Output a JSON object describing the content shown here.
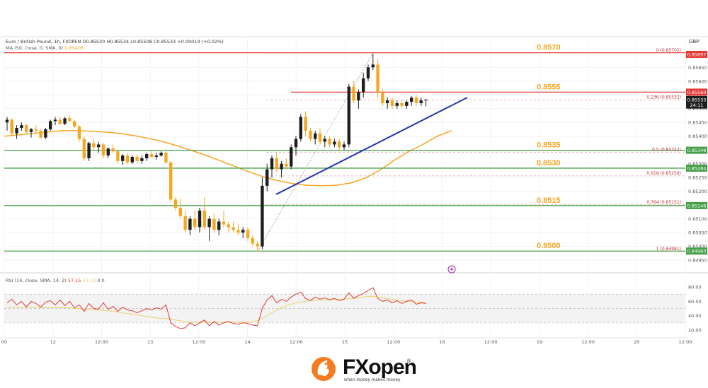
{
  "header": {
    "symbol_line": "Euro / British Pound, 1h, FXOPEN  O0.85520  H0.85534  L0.85508  C0.85533  +0.00014 (+0.02%)",
    "ma_line_prefix": "MA (50, close, 0, SMA, 0)",
    "ma_value": "0.85406",
    "currency": "GBP"
  },
  "rsi_header": {
    "prefix": "RSI (14, close, SMA, 14, 2)",
    "rsi_value": "57.15",
    "sma_value": "52.13",
    "suffix": "0  0"
  },
  "colors": {
    "bull": "#1e1e1e",
    "bear": "#f5a623",
    "ma": "#f5a623",
    "trendline": "#2233bb",
    "resistance": "#e53935",
    "support": "#43a047",
    "level_text": "#f5a623",
    "rsi": "#e53935",
    "rsi_sma": "#e8d36a"
  },
  "icons": [
    "lightning-icon"
  ],
  "brand": {
    "name": "FXopen",
    "tagline": "when money makes money",
    "reg": "®"
  },
  "chart_data": {
    "type": "candlestick",
    "title": "Euro / British Pound, 1h, FXOPEN",
    "ylim": [
      0.8494,
      0.8572
    ],
    "y_ticks": [
      "0.85650",
      "0.85600",
      "0.85550",
      "0.85500",
      "0.85450",
      "0.85400",
      "0.85350",
      "0.85300",
      "0.85250",
      "0.85200",
      "0.85150",
      "0.85100",
      "0.85050",
      "0.85000",
      "0.84950"
    ],
    "x_ticks": [
      "00",
      "12",
      "12:00",
      "13",
      "12:00",
      "14",
      "12:00",
      "15",
      "12:00",
      "16",
      "12:00",
      "19",
      "12:00",
      "20",
      "12:00"
    ],
    "candles": [
      [
        0.8545,
        0.8547,
        0.8542,
        0.8546
      ],
      [
        0.8546,
        0.85465,
        0.854,
        0.8541
      ],
      [
        0.8541,
        0.8544,
        0.8539,
        0.8543
      ],
      [
        0.8543,
        0.8545,
        0.8542,
        0.8544
      ],
      [
        0.8544,
        0.85445,
        0.8541,
        0.85415
      ],
      [
        0.85415,
        0.8543,
        0.85395,
        0.85425
      ],
      [
        0.85425,
        0.8544,
        0.8541,
        0.8542
      ],
      [
        0.8542,
        0.85425,
        0.8539,
        0.85395
      ],
      [
        0.85395,
        0.8543,
        0.8539,
        0.85425
      ],
      [
        0.85425,
        0.8546,
        0.8542,
        0.85455
      ],
      [
        0.85455,
        0.8547,
        0.8544,
        0.8546
      ],
      [
        0.8546,
        0.8547,
        0.8544,
        0.85445
      ],
      [
        0.85445,
        0.8547,
        0.8544,
        0.85465
      ],
      [
        0.85465,
        0.85475,
        0.8545,
        0.85455
      ],
      [
        0.85455,
        0.8546,
        0.8543,
        0.85435
      ],
      [
        0.85435,
        0.8544,
        0.8538,
        0.8539
      ],
      [
        0.8539,
        0.854,
        0.8531,
        0.8532
      ],
      [
        0.8532,
        0.8538,
        0.8531,
        0.85375
      ],
      [
        0.85375,
        0.8539,
        0.8535,
        0.8536
      ],
      [
        0.8536,
        0.8538,
        0.8534,
        0.8537
      ],
      [
        0.8537,
        0.85375,
        0.8532,
        0.8533
      ],
      [
        0.8533,
        0.8536,
        0.8532,
        0.85355
      ],
      [
        0.85355,
        0.8537,
        0.8534,
        0.85345
      ],
      [
        0.85345,
        0.8535,
        0.853,
        0.8531
      ],
      [
        0.8531,
        0.85335,
        0.85295,
        0.8533
      ],
      [
        0.8533,
        0.8534,
        0.853,
        0.85305
      ],
      [
        0.85305,
        0.8533,
        0.853,
        0.85325
      ],
      [
        0.85325,
        0.85335,
        0.85305,
        0.8531
      ],
      [
        0.8531,
        0.8533,
        0.853,
        0.8532
      ],
      [
        0.8532,
        0.8534,
        0.8531,
        0.85335
      ],
      [
        0.85335,
        0.85345,
        0.8532,
        0.85325
      ],
      [
        0.85325,
        0.8534,
        0.85315,
        0.8533
      ],
      [
        0.8533,
        0.85345,
        0.85325,
        0.8534
      ],
      [
        0.8534,
        0.85345,
        0.853,
        0.85305
      ],
      [
        0.85305,
        0.8531,
        0.8516,
        0.8517
      ],
      [
        0.8517,
        0.8518,
        0.8513,
        0.8514
      ],
      [
        0.8514,
        0.85175,
        0.851,
        0.8511
      ],
      [
        0.8511,
        0.8513,
        0.8505,
        0.8506
      ],
      [
        0.8506,
        0.8511,
        0.8504,
        0.851
      ],
      [
        0.851,
        0.8513,
        0.8506,
        0.8507
      ],
      [
        0.8507,
        0.8514,
        0.8505,
        0.8513
      ],
      [
        0.8513,
        0.8518,
        0.8506,
        0.8507
      ],
      [
        0.8507,
        0.8511,
        0.8502,
        0.851
      ],
      [
        0.851,
        0.8512,
        0.8505,
        0.8506
      ],
      [
        0.8506,
        0.851,
        0.8504,
        0.8509
      ],
      [
        0.8509,
        0.8513,
        0.8507,
        0.8508
      ],
      [
        0.8508,
        0.8509,
        0.8505,
        0.8507
      ],
      [
        0.8507,
        0.8509,
        0.8505,
        0.8506
      ],
      [
        0.8506,
        0.8508,
        0.8504,
        0.8505
      ],
      [
        0.8505,
        0.8507,
        0.8503,
        0.8506
      ],
      [
        0.8506,
        0.8507,
        0.8502,
        0.8503
      ],
      [
        0.8503,
        0.8504,
        0.85,
        0.8501
      ],
      [
        0.8501,
        0.8502,
        0.8498,
        0.85
      ],
      [
        0.85,
        0.8525,
        0.8499,
        0.8522
      ],
      [
        0.8522,
        0.853,
        0.852,
        0.8528
      ],
      [
        0.8528,
        0.8533,
        0.8525,
        0.8532
      ],
      [
        0.8532,
        0.8534,
        0.8527,
        0.8528
      ],
      [
        0.8528,
        0.8531,
        0.8525,
        0.853
      ],
      [
        0.853,
        0.8532,
        0.8528,
        0.8529
      ],
      [
        0.8529,
        0.8537,
        0.8528,
        0.8536
      ],
      [
        0.8536,
        0.854,
        0.8533,
        0.8539
      ],
      [
        0.8539,
        0.8548,
        0.8538,
        0.8547
      ],
      [
        0.8547,
        0.8549,
        0.854,
        0.8542
      ],
      [
        0.8542,
        0.8543,
        0.8538,
        0.8539
      ],
      [
        0.8539,
        0.8542,
        0.8537,
        0.8541
      ],
      [
        0.8541,
        0.8543,
        0.8537,
        0.8538
      ],
      [
        0.8538,
        0.854,
        0.8536,
        0.8539
      ],
      [
        0.8539,
        0.854,
        0.8536,
        0.8537
      ],
      [
        0.8537,
        0.8539,
        0.8536,
        0.8538
      ],
      [
        0.8538,
        0.8539,
        0.8535,
        0.8536
      ],
      [
        0.8536,
        0.8538,
        0.8535,
        0.8537
      ],
      [
        0.8537,
        0.8559,
        0.8536,
        0.8558
      ],
      [
        0.8558,
        0.856,
        0.8552,
        0.8553
      ],
      [
        0.8553,
        0.8557,
        0.855,
        0.8556
      ],
      [
        0.8556,
        0.8563,
        0.8554,
        0.8561
      ],
      [
        0.8561,
        0.8566,
        0.856,
        0.8565
      ],
      [
        0.8565,
        0.857,
        0.8564,
        0.8566
      ],
      [
        0.8566,
        0.8568,
        0.8554,
        0.8556
      ],
      [
        0.8556,
        0.8557,
        0.8551,
        0.8552
      ],
      [
        0.8552,
        0.8554,
        0.855,
        0.8553
      ],
      [
        0.8553,
        0.8554,
        0.855,
        0.8551
      ],
      [
        0.8551,
        0.8553,
        0.855,
        0.8552
      ],
      [
        0.8552,
        0.8553,
        0.855,
        0.8551
      ],
      [
        0.8551,
        0.8553,
        0.855,
        0.85525
      ],
      [
        0.85525,
        0.85545,
        0.8551,
        0.8554
      ],
      [
        0.8554,
        0.8555,
        0.8551,
        0.8552
      ],
      [
        0.8552,
        0.8554,
        0.8551,
        0.8553
      ],
      [
        0.8553,
        0.85534,
        0.85508,
        0.85533
      ]
    ],
    "ma50": [
      0.854,
      0.85405,
      0.8541,
      0.85415,
      0.8542,
      0.8542,
      0.85418,
      0.85415,
      0.8541,
      0.85402,
      0.85392,
      0.8538,
      0.85365,
      0.85348,
      0.8533,
      0.8531,
      0.8529,
      0.8527,
      0.85252,
      0.85238,
      0.85228,
      0.85222,
      0.8522,
      0.85222,
      0.8523,
      0.85248,
      0.85276,
      0.85312,
      0.85344,
      0.8537,
      0.854,
      0.8542
    ],
    "horizontal_levels": [
      {
        "label": "0.8570",
        "value": 0.85703,
        "kind": "resistance"
      },
      {
        "label": "0.8555",
        "value": 0.8556,
        "kind": "resistance"
      },
      {
        "label": "0.8535",
        "value": 0.85349,
        "kind": "support"
      },
      {
        "label": "0.8530",
        "value": 0.85284,
        "kind": "support"
      },
      {
        "label": "0.8515",
        "value": 0.85148,
        "kind": "support"
      },
      {
        "label": "0.8500",
        "value": 0.84983,
        "kind": "support"
      }
    ],
    "fib_levels": [
      {
        "label": "0 (0.85702)",
        "value": 0.85702
      },
      {
        "label": "0.236 (0.85532)",
        "value": 0.85532
      },
      {
        "label": "0.5 (0.85342)",
        "value": 0.85342
      },
      {
        "label": "0.618 (0.85256)",
        "value": 0.85256
      },
      {
        "label": "0.764 (0.85151)",
        "value": 0.85151
      },
      {
        "label": "1 (0.84981)",
        "value": 0.84981
      }
    ],
    "price_tags": [
      {
        "label": "0.85697",
        "value": 0.85697,
        "color": "#e53935"
      },
      {
        "label": "0.85560",
        "value": 0.8556,
        "color": "#e53935"
      },
      {
        "label": "0.85533",
        "value": 0.85533,
        "color": "#1e1e1e"
      },
      {
        "label": "24:11",
        "value": 0.85513,
        "color": "#1e1e1e"
      },
      {
        "label": "0.85349",
        "value": 0.85349,
        "color": "#43a047"
      },
      {
        "label": "0.85284",
        "value": 0.85284,
        "color": "#43a047"
      },
      {
        "label": "0.85148",
        "value": 0.85148,
        "color": "#43a047"
      },
      {
        "label": "0.84983",
        "value": 0.84983,
        "color": "#43a047"
      }
    ],
    "trendline": {
      "from_index": 53,
      "from_value": 0.8521,
      "to_index": 89,
      "to_value": 0.8555
    },
    "rsi": {
      "ylim": [
        17,
        88
      ],
      "y_ticks": [
        "80.00",
        "60.00",
        "40.00",
        "20.00"
      ],
      "band": [
        30,
        70
      ],
      "values": [
        58,
        63,
        55,
        60,
        52,
        60,
        57,
        52,
        59,
        61,
        55,
        62,
        54,
        60,
        51,
        55,
        46,
        57,
        50,
        49,
        58,
        49,
        53,
        46,
        52,
        48,
        47,
        44,
        47,
        50,
        48,
        51,
        49,
        55,
        30,
        25,
        22,
        23,
        30,
        26,
        30,
        34,
        26,
        32,
        27,
        30,
        32,
        29,
        28,
        30,
        29,
        27,
        26,
        50,
        62,
        68,
        58,
        63,
        60,
        66,
        70,
        73,
        64,
        61,
        66,
        63,
        65,
        62,
        64,
        61,
        63,
        72,
        64,
        68,
        71,
        75,
        79,
        64,
        60,
        62,
        58,
        61,
        57,
        60,
        62,
        56,
        58,
        57
      ],
      "sma": [
        52,
        52,
        52,
        52,
        52,
        52,
        52,
        51,
        51,
        51,
        51,
        51,
        51,
        51,
        50,
        50,
        49,
        49,
        48,
        48,
        47,
        47,
        46,
        45,
        44,
        43,
        42,
        41,
        40,
        39,
        38,
        37,
        36,
        36,
        35,
        34,
        33,
        32,
        31,
        31,
        31,
        31,
        31,
        31,
        31,
        31,
        31,
        31,
        31,
        31,
        31,
        32,
        33,
        36,
        40,
        44,
        48,
        51,
        54,
        56,
        58,
        59,
        60,
        61,
        61,
        62,
        62,
        62,
        63,
        63,
        63,
        64,
        64,
        65,
        66,
        67,
        67,
        66,
        65,
        64,
        63,
        62,
        61,
        60,
        60,
        59,
        59,
        58
      ]
    }
  }
}
